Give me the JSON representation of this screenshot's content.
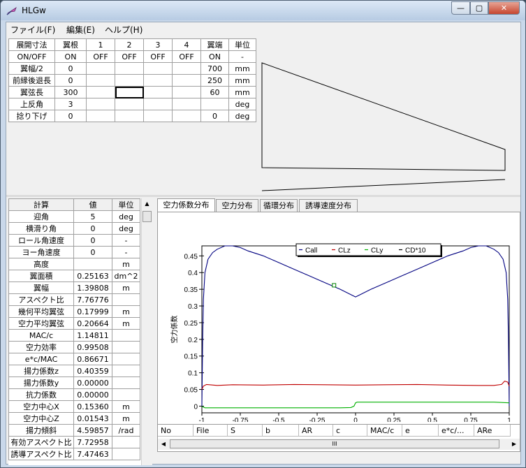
{
  "window": {
    "title": "HLGw",
    "min": "—",
    "max": "▢",
    "close": "✕"
  },
  "menu": [
    "ファイル(F)",
    "編集(E)",
    "ヘルプ(H)"
  ],
  "dim_table": {
    "headers": [
      "展開寸法",
      "翼根",
      "1",
      "2",
      "3",
      "4",
      "翼端",
      "単位"
    ],
    "rows": [
      [
        "ON/OFF",
        "ON",
        "OFF",
        "OFF",
        "OFF",
        "OFF",
        "ON",
        "-"
      ],
      [
        "翼幅/2",
        "0",
        "",
        "",
        "",
        "",
        "700",
        "mm"
      ],
      [
        "前縁後退長",
        "0",
        "",
        "",
        "",
        "",
        "250",
        "mm"
      ],
      [
        "翼弦長",
        "300",
        "",
        "",
        "",
        "",
        "60",
        "mm"
      ],
      [
        "上反角",
        "3",
        "",
        "",
        "",
        "",
        "",
        "deg"
      ],
      [
        "捻り下げ",
        "0",
        "",
        "",
        "",
        "",
        "0",
        "deg"
      ]
    ]
  },
  "calc_table": {
    "headers": [
      "計算",
      "値",
      "単位"
    ],
    "rows": [
      [
        "迎角",
        "5",
        "deg"
      ],
      [
        "横滑り角",
        "0",
        "deg"
      ],
      [
        "ロール角速度",
        "0",
        "-"
      ],
      [
        "ヨー角速度",
        "0",
        "-"
      ],
      [
        "高度",
        "",
        "m"
      ],
      [
        "翼面積",
        "0.25163",
        "dm^2"
      ],
      [
        "翼幅",
        "1.39808",
        "m"
      ],
      [
        "アスペクト比",
        "7.76776",
        ""
      ],
      [
        "幾何平均翼弦",
        "0.17999",
        "m"
      ],
      [
        "空力平均翼弦",
        "0.20664",
        "m"
      ],
      [
        "MAC/c",
        "1.14811",
        ""
      ],
      [
        "空力効率",
        "0.99508",
        ""
      ],
      [
        "e*c/MAC",
        "0.86671",
        ""
      ],
      [
        "揚力係数z",
        "0.40359",
        ""
      ],
      [
        "揚力係数y",
        "0.00000",
        ""
      ],
      [
        "抗力係数",
        "0.00000",
        ""
      ],
      [
        "空力中心X",
        "0.15360",
        "m"
      ],
      [
        "空力中心Z",
        "0.01543",
        "m"
      ],
      [
        "揚力傾斜",
        "4.59857",
        "/rad"
      ],
      [
        "有効アスペクト比",
        "7.72958",
        ""
      ],
      [
        "誘導アスペクト比",
        "7.47463",
        ""
      ]
    ]
  },
  "tabs": [
    "空力係数分布",
    "空力分布",
    "循環分布",
    "誘導速度分布"
  ],
  "list_columns": [
    "No",
    "File",
    "S",
    "b",
    "AR",
    "c",
    "MAC/c",
    "e",
    "e*c/...",
    "ARe"
  ],
  "hscroll_label": "III",
  "chart_data": {
    "type": "line",
    "xlabel": "規格化スパン方向位置(Y)",
    "ylabel": "空力係数",
    "xlim": [
      -1,
      1
    ],
    "ylim": [
      -0.02,
      0.48
    ],
    "xticks": [
      -1,
      -0.75,
      -0.5,
      -0.25,
      0,
      0.25,
      0.5,
      0.75,
      1
    ],
    "xtick_labels": [
      "-1",
      "-0.75",
      "-0.5",
      "-0.25",
      "0",
      "0.25",
      "0.5",
      "0.75",
      "1"
    ],
    "yticks": [
      0,
      0.05,
      0.1,
      0.15,
      0.2,
      0.25,
      0.3,
      0.35,
      0.4,
      0.45
    ],
    "ytick_labels": [
      "0",
      "0.05",
      "0.1",
      "0.15",
      "0.2",
      "0.25",
      "0.3",
      "0.35",
      "0.4",
      "0.45"
    ],
    "legend_position": "top-center",
    "series": [
      {
        "name": "Call",
        "color": "#000080",
        "x": [
          -1,
          -0.995,
          -0.99,
          -0.98,
          -0.96,
          -0.93,
          -0.9,
          -0.85,
          -0.8,
          -0.75,
          -0.7,
          -0.6,
          -0.5,
          -0.4,
          -0.3,
          -0.2,
          -0.1,
          0,
          0.1,
          0.2,
          0.3,
          0.4,
          0.5,
          0.6,
          0.7,
          0.75,
          0.8,
          0.85,
          0.9,
          0.93,
          0.96,
          0.98,
          0.99,
          0.995,
          1
        ],
        "y": [
          0,
          0.2,
          0.32,
          0.4,
          0.44,
          0.46,
          0.47,
          0.48,
          0.48,
          0.475,
          0.465,
          0.45,
          0.43,
          0.41,
          0.39,
          0.37,
          0.35,
          0.327,
          0.35,
          0.37,
          0.39,
          0.41,
          0.43,
          0.45,
          0.465,
          0.475,
          0.48,
          0.48,
          0.47,
          0.46,
          0.44,
          0.4,
          0.32,
          0.2,
          0
        ]
      },
      {
        "name": "CLz",
        "color": "#c00000",
        "x": [
          -1,
          -0.99,
          -0.97,
          -0.9,
          -0.8,
          -0.6,
          -0.4,
          -0.2,
          0,
          0.2,
          0.4,
          0.6,
          0.8,
          0.9,
          0.95,
          0.97,
          0.99,
          1
        ],
        "y": [
          0.05,
          0.06,
          0.065,
          0.062,
          0.064,
          0.063,
          0.065,
          0.064,
          0.063,
          0.064,
          0.065,
          0.063,
          0.062,
          0.062,
          0.065,
          0.075,
          0.072,
          0.06
        ]
      },
      {
        "name": "CLy",
        "color": "#00b000",
        "x": [
          -1,
          -0.99,
          -0.98,
          -0.1,
          -0.03,
          -0.01,
          0,
          0.01,
          0.05,
          0.3,
          0.6,
          0.9,
          1
        ],
        "y": [
          -0.001,
          -0.003,
          -0.005,
          -0.005,
          -0.004,
          0.0,
          0.01,
          0.012,
          0.012,
          0.012,
          0.012,
          0.012,
          0.01
        ]
      },
      {
        "name": "CD*10",
        "color": "#000000",
        "x": [],
        "y": []
      }
    ],
    "marker": {
      "x": -0.14,
      "y": 0.362
    }
  }
}
